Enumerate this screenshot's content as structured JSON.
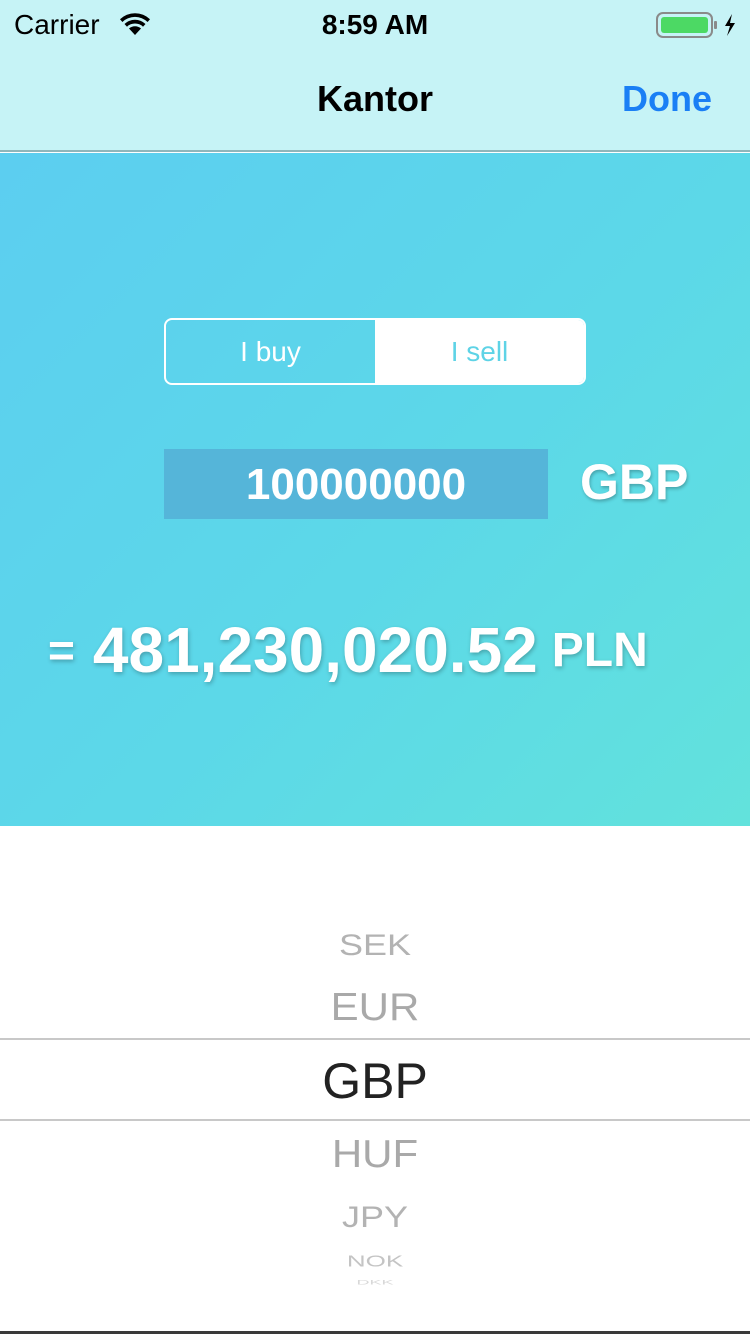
{
  "status_bar": {
    "carrier": "Carrier",
    "time": "8:59 AM",
    "wifi_icon": "wifi-icon",
    "battery_icon": "battery-charging-icon",
    "battery_color": "#4cd964"
  },
  "nav": {
    "title": "Kantor",
    "done_label": "Done",
    "accent_color": "#1a7ff5"
  },
  "exchange": {
    "segments": [
      "I buy",
      "I sell"
    ],
    "selected_segment": "I sell",
    "amount_value": "100000000",
    "from_currency": "GBP",
    "equals_sign": "=",
    "result_value": "481,230,020.52",
    "to_currency": "PLN"
  },
  "picker": {
    "items": [
      "SEK",
      "EUR",
      "GBP",
      "HUF",
      "JPY",
      "NOK",
      "DKK"
    ],
    "selected": "GBP"
  }
}
